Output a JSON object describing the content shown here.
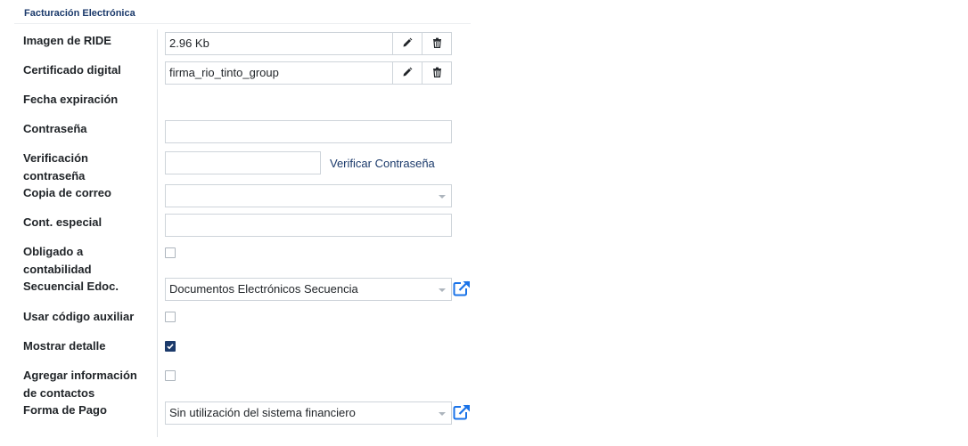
{
  "section": {
    "title": "Facturación Electrónica"
  },
  "fields": {
    "imagen_ride": {
      "label": "Imagen de RIDE",
      "value": "2.96 Kb"
    },
    "certificado": {
      "label": "Certificado digital",
      "value": "firma_rio_tinto_group"
    },
    "fecha_expiracion": {
      "label": "Fecha expiración"
    },
    "contrasena": {
      "label": "Contraseña",
      "value": ""
    },
    "verificacion": {
      "label_line1": "Verificación",
      "label_line2": "contraseña",
      "value": "",
      "action": "Verificar Contraseña"
    },
    "copia_correo": {
      "label": "Copia de correo",
      "value": ""
    },
    "cont_especial": {
      "label": "Cont. especial",
      "value": ""
    },
    "obligado": {
      "label_line1": "Obligado a",
      "label_line2": "contabilidad",
      "checked": false
    },
    "secuencial": {
      "label": "Secuencial Edoc.",
      "value": "Documentos Electrónicos Secuencia"
    },
    "usar_codigo": {
      "label": "Usar código auxiliar",
      "checked": false
    },
    "mostrar_detalle": {
      "label": "Mostrar detalle",
      "checked": true
    },
    "agregar_info": {
      "label_line1": "Agregar información",
      "label_line2": "de contactos",
      "checked": false
    },
    "forma_pago": {
      "label": "Forma de Pago",
      "value": "Sin utilización del sistema financiero"
    }
  },
  "icons": {
    "edit": "pencil-icon",
    "delete": "trash-icon",
    "external": "external-link-icon"
  },
  "colors": {
    "accent": "#1b3a6b",
    "link_icon": "#1a73e8",
    "border": "#ced4da"
  }
}
